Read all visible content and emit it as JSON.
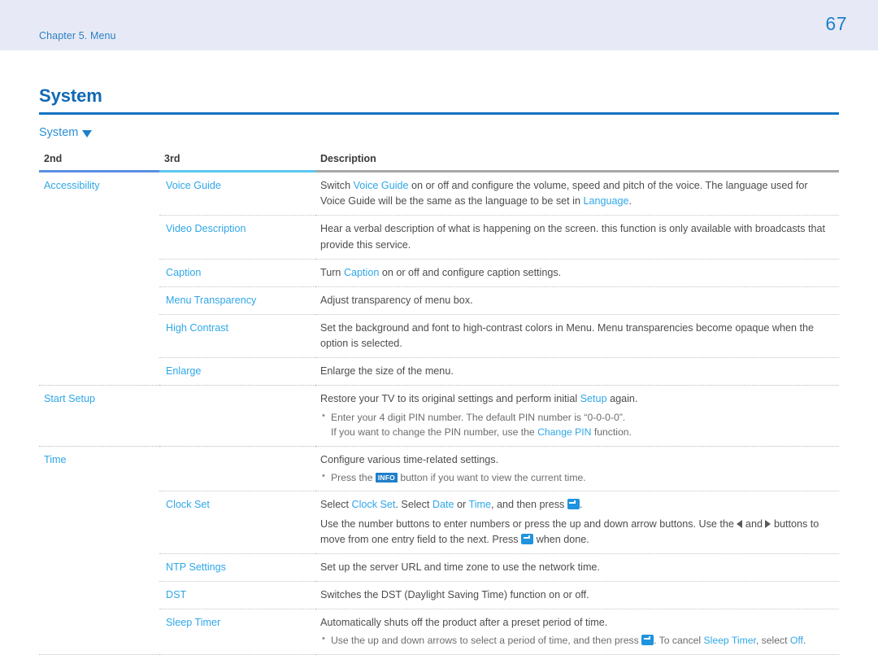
{
  "header": {
    "chapter": "Chapter 5. Menu",
    "page_number": "67",
    "band_color": "#e7eaf6",
    "accent_color": "#1f7fc9"
  },
  "section": {
    "title": "System",
    "subsection": "System",
    "caret_icon": "caret-down-icon"
  },
  "table": {
    "columns": [
      "2nd",
      "3rd",
      "Description"
    ],
    "rows": [
      {
        "second": "Accessibility",
        "third": "Voice Guide",
        "desc_parts": [
          {
            "t": "Switch "
          },
          {
            "t": "Voice Guide",
            "hl": true
          },
          {
            "t": " on or off and configure the volume, speed and pitch of the voice. The language used for Voice Guide will be the same as the language to be set in "
          },
          {
            "t": "Language",
            "hl": true
          },
          {
            "t": "."
          }
        ]
      },
      {
        "second": "",
        "third": "Video Description",
        "desc_parts": [
          {
            "t": "Hear a verbal description of what is happening on the screen. this function is only available with broadcasts that provide this service."
          }
        ]
      },
      {
        "second": "",
        "third": "Caption",
        "desc_parts": [
          {
            "t": "Turn "
          },
          {
            "t": "Caption",
            "hl": true
          },
          {
            "t": " on or off and configure caption settings."
          }
        ]
      },
      {
        "second": "",
        "third": "Menu Transparency",
        "desc_parts": [
          {
            "t": "Adjust transparency of menu box."
          }
        ]
      },
      {
        "second": "",
        "third": "High Contrast",
        "desc_parts": [
          {
            "t": "Set the background and font to high-contrast colors in Menu. Menu transparencies become opaque when the option is selected."
          }
        ]
      },
      {
        "second": "",
        "third": "Enlarge",
        "desc_parts": [
          {
            "t": "Enlarge the size of the menu."
          }
        ]
      },
      {
        "second": "Start Setup",
        "third": "",
        "desc_parts": [
          {
            "t": "Restore your TV to its original settings and perform initial "
          },
          {
            "t": "Setup",
            "hl": true
          },
          {
            "t": " again."
          }
        ],
        "bullets": [
          {
            "text": "Enter your 4 digit PIN number. The default PIN number is “0-0-0-0”."
          },
          {
            "continuation": true,
            "parts": [
              {
                "t": "If you want to change the PIN number, use the "
              },
              {
                "t": "Change PIN",
                "hl": true
              },
              {
                "t": " function."
              }
            ]
          }
        ]
      },
      {
        "second": "Time",
        "third": "",
        "desc_parts": [
          {
            "t": "Configure various time-related settings."
          }
        ],
        "bullets": [
          {
            "parts": [
              {
                "t": "Press the "
              },
              {
                "key": "INFO"
              },
              {
                "t": " button if you want to view the current time."
              }
            ]
          }
        ]
      },
      {
        "second": "",
        "third": "Clock Set",
        "desc_parts": [
          {
            "t": "Select "
          },
          {
            "t": "Clock Set",
            "hl": true
          },
          {
            "t": ". Select "
          },
          {
            "t": "Date",
            "hl": true
          },
          {
            "t": " or "
          },
          {
            "t": "Time",
            "hl": true
          },
          {
            "t": ", and then press "
          },
          {
            "enter": true
          },
          {
            "t": "."
          }
        ],
        "extra_parts": [
          {
            "t": "Use the number buttons to enter numbers or press the up and down arrow buttons. Use the "
          },
          {
            "arrow": "left"
          },
          {
            "t": " and "
          },
          {
            "arrow": "right"
          },
          {
            "t": " buttons to move from one entry field to the next. Press "
          },
          {
            "enter": true
          },
          {
            "t": " when done."
          }
        ]
      },
      {
        "second": "",
        "third": "NTP Settings",
        "desc_parts": [
          {
            "t": "Set up the server URL and time zone to use the network time."
          }
        ]
      },
      {
        "second": "",
        "third": "DST",
        "desc_parts": [
          {
            "t": "Switches the DST (Daylight Saving Time) function on or off."
          }
        ]
      },
      {
        "second": "",
        "third": "Sleep Timer",
        "desc_parts": [
          {
            "t": "Automatically shuts off the product after a preset period of time."
          }
        ],
        "bullets": [
          {
            "parts": [
              {
                "t": "Use the up and down arrows to select a period of time, and then press "
              },
              {
                "enter": true
              },
              {
                "t": ". To cancel "
              },
              {
                "t": "Sleep Timer",
                "hl": true
              },
              {
                "t": ", select "
              },
              {
                "t": "Off",
                "hl": true
              },
              {
                "t": "."
              }
            ]
          }
        ]
      }
    ]
  }
}
